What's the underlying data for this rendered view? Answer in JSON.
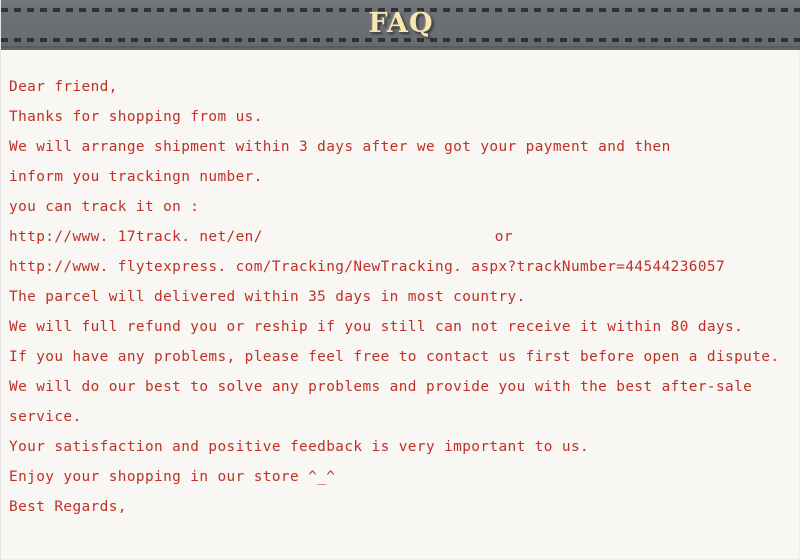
{
  "banner": {
    "title": "FAQ",
    "title_color": "#f6e6b0",
    "band_color": "#6e7175",
    "stitch_color": "#2f3134"
  },
  "page": {
    "background_color": "#f8f7f4",
    "text_color": "#bf3026"
  },
  "letter": {
    "lines": [
      {
        "text": "Dear friend,"
      },
      {
        "text": "Thanks for shopping from us."
      },
      {
        "text": "We will arrange shipment within 3 days after we got your payment and then"
      },
      {
        "text": "inform you trackingn number."
      },
      {
        "text": "you can track it on :"
      },
      {
        "text": "http://www. 17track. net/en/",
        "trailing": "or"
      },
      {
        "text": "http://www. flytexpress. com/Tracking/NewTracking. aspx?trackNumber=44544236057"
      },
      {
        "text": "The parcel will delivered within 35 days in most country."
      },
      {
        "text": "We will full refund you or reship if you still can not receive it within 80 days."
      },
      {
        "text": "If you have any problems, please feel free to contact us first before open a dispute."
      },
      {
        "text": "We will do our best to solve any problems and provide you with the best after-sale"
      },
      {
        "text": "service."
      },
      {
        "text": "Your satisfaction and positive feedback is very important to us."
      },
      {
        "text": "Enjoy your shopping in our store ^_^"
      },
      {
        "text": "Best Regards,"
      }
    ],
    "tracking_number": "44544236057",
    "shipping_days": "3 days",
    "delivery_days": "35 days",
    "refund_days": "80 days",
    "emoticon": "^_^",
    "or_separator": "or"
  }
}
